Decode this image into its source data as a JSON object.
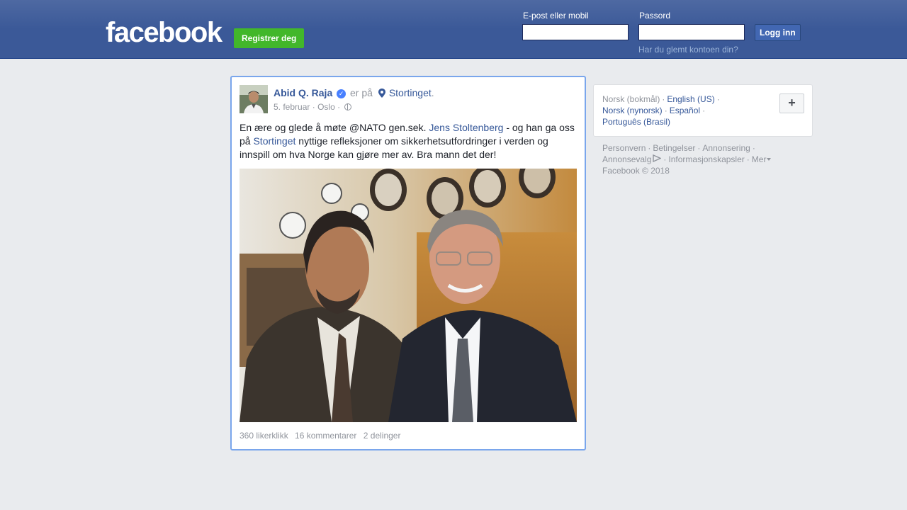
{
  "header": {
    "logo": "facebook",
    "register_label": "Registrer deg",
    "email_label": "E-post eller mobil",
    "password_label": "Passord",
    "email_value": "",
    "password_value": "",
    "login_label": "Logg inn",
    "forgot_label": "Har du glemt kontoen din?"
  },
  "post": {
    "author": "Abid Q. Raja",
    "is_at": "er på",
    "place": "Stortinget",
    "place_suffix": ".",
    "date": "5. februar",
    "location": "Oslo",
    "text_part1": "En ære og glede å møte @NATO gen.sek. ",
    "mention1": "Jens Stoltenberg",
    "text_part2": " - og han ga oss på ",
    "mention2": "Stortinget",
    "text_part3": " nyttige refleksjoner om sikkerhetsutfordringer i verden og innspill om hva Norge kan gjøre mer av. Bra mann det der!",
    "likes": "360 likerklikk",
    "comments": "16 kommentarer",
    "shares": "2 delinger"
  },
  "languages": {
    "current": "Norsk (bokmål)",
    "options": [
      "English (US)",
      "Norsk (nynorsk)",
      "Español",
      "Português (Brasil)"
    ],
    "add_label": "+"
  },
  "footer": {
    "links": [
      "Personvern",
      "Betingelser",
      "Annonsering",
      "Annonsevalg",
      "Informasjonskapsler",
      "Mer"
    ],
    "copyright": "Facebook © 2018"
  },
  "colors": {
    "header_blue": "#3b5998",
    "link_blue": "#365899",
    "register_green": "#42b72a",
    "verified_blue": "#4880ff"
  }
}
